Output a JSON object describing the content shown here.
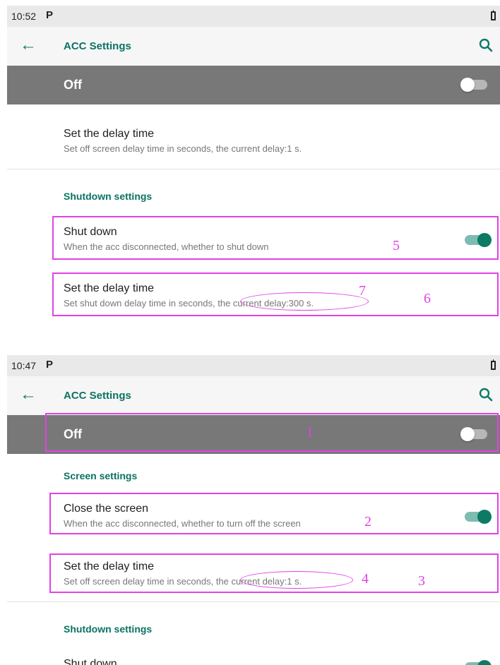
{
  "top_screen": {
    "status_time": "10:52",
    "status_icon_label": "P",
    "app_title": "ACC Settings",
    "master_label": "Off",
    "screen_delay_title": "Set the delay time",
    "screen_delay_summary": "Set off screen delay time in seconds, the current delay:1 s.",
    "shutdown_header": "Shutdown settings",
    "shutdown_title": "Shut down",
    "shutdown_summary": "When the acc disconnected, whether to shut down",
    "shutdown_delay_title": "Set the delay time",
    "shutdown_delay_summary": "Set shut down delay time in seconds, the current delay:300 s.",
    "annotations": {
      "n5": "5",
      "n6": "6",
      "n7": "7"
    }
  },
  "bottom_screen": {
    "status_time": "10:47",
    "status_icon_label": "P",
    "app_title": "ACC Settings",
    "master_label": "Off",
    "screen_header": "Screen settings",
    "close_screen_title": "Close the screen",
    "close_screen_summary": "When the acc disconnected, whether to turn off the screen",
    "screen_delay_title": "Set the delay time",
    "screen_delay_summary": "Set off screen delay time in seconds, the current delay:1 s.",
    "shutdown_header": "Shutdown settings",
    "shutdown_title": "Shut down",
    "annotations": {
      "n1": "1",
      "n2": "2",
      "n3": "3",
      "n4": "4"
    }
  },
  "icons": {
    "back": "arrow-back-icon",
    "search": "search-icon",
    "battery": "battery-icon",
    "status_p": "p-notification-icon"
  },
  "colors": {
    "accent": "#0b7263",
    "master_bar": "#787878",
    "annotation": "#e142e6",
    "switch_on_thumb": "#0d7a66",
    "switch_on_track": "#7dbdb1"
  },
  "toggles": {
    "top_master": false,
    "top_shutdown": true,
    "bottom_master": false,
    "bottom_close_screen": true,
    "bottom_shutdown": true
  }
}
